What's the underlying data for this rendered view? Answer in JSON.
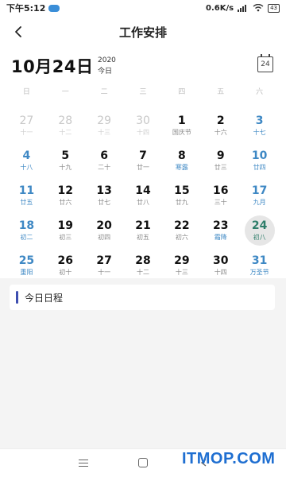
{
  "status_bar": {
    "time": "下午5:12",
    "network_speed": "0.6K/s",
    "battery": "43"
  },
  "header": {
    "title": "工作安排",
    "back_icon": "chevron-left-icon"
  },
  "date_header": {
    "current_date": "10月24日",
    "year": "2020",
    "today_label": "今日",
    "calendar_icon_day": "24"
  },
  "weekdays": [
    "日",
    "一",
    "二",
    "三",
    "四",
    "五",
    "六"
  ],
  "calendar": {
    "weeks": [
      [
        {
          "day": "27",
          "lunar": "十一",
          "muted": true
        },
        {
          "day": "28",
          "lunar": "十二",
          "muted": true
        },
        {
          "day": "29",
          "lunar": "十三",
          "muted": true
        },
        {
          "day": "30",
          "lunar": "十四",
          "muted": true
        },
        {
          "day": "1",
          "lunar": "国庆节"
        },
        {
          "day": "2",
          "lunar": "十六"
        },
        {
          "day": "3",
          "lunar": "十七",
          "weekend": true
        }
      ],
      [
        {
          "day": "4",
          "lunar": "十八",
          "weekend": true
        },
        {
          "day": "5",
          "lunar": "十九"
        },
        {
          "day": "6",
          "lunar": "二十"
        },
        {
          "day": "7",
          "lunar": "廿一"
        },
        {
          "day": "8",
          "lunar": "寒露",
          "term": true
        },
        {
          "day": "9",
          "lunar": "廿三"
        },
        {
          "day": "10",
          "lunar": "廿四",
          "weekend": true
        }
      ],
      [
        {
          "day": "11",
          "lunar": "廿五",
          "weekend": true
        },
        {
          "day": "12",
          "lunar": "廿六"
        },
        {
          "day": "13",
          "lunar": "廿七"
        },
        {
          "day": "14",
          "lunar": "廿八"
        },
        {
          "day": "15",
          "lunar": "廿九"
        },
        {
          "day": "16",
          "lunar": "三十"
        },
        {
          "day": "17",
          "lunar": "九月",
          "weekend": true
        }
      ],
      [
        {
          "day": "18",
          "lunar": "初二",
          "weekend": true
        },
        {
          "day": "19",
          "lunar": "初三"
        },
        {
          "day": "20",
          "lunar": "初四"
        },
        {
          "day": "21",
          "lunar": "初五"
        },
        {
          "day": "22",
          "lunar": "初六"
        },
        {
          "day": "23",
          "lunar": "霜降",
          "term": true
        },
        {
          "day": "24",
          "lunar": "初八",
          "today": true
        }
      ],
      [
        {
          "day": "25",
          "lunar": "重阳",
          "weekend": true
        },
        {
          "day": "26",
          "lunar": "初十"
        },
        {
          "day": "27",
          "lunar": "十一"
        },
        {
          "day": "28",
          "lunar": "十二"
        },
        {
          "day": "29",
          "lunar": "十三"
        },
        {
          "day": "30",
          "lunar": "十四"
        },
        {
          "day": "31",
          "lunar": "万圣节",
          "weekend": true
        }
      ]
    ]
  },
  "schedule": {
    "title": "今日日程"
  },
  "watermark": "ITMOP.COM",
  "colors": {
    "accent": "#3e88c4",
    "today": "#2e7d6a",
    "schedule_bar": "#3e4fb0"
  }
}
